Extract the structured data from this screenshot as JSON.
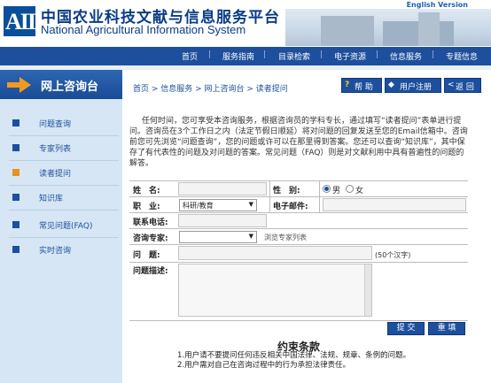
{
  "header": {
    "logo_mark": "AII",
    "title_cn": "中国农业科技文献与信息服务平台",
    "title_en": "National Agricultural Information System",
    "english_link": "English Version"
  },
  "nav": {
    "items": [
      "首页",
      "服务指南",
      "目录检索",
      "电子资源",
      "信息服务",
      "专题信息"
    ]
  },
  "sidebar": {
    "heading": "网上咨询台",
    "items": [
      "问题查询",
      "专家列表",
      "读者提问",
      "知识库",
      "常见问题(FAQ)",
      "实时咨询"
    ]
  },
  "breadcrumb": "首页 > 信息服务 > 网上咨询台 > 读者提问",
  "toolbar": {
    "help": "帮 助",
    "register": "用户注册",
    "back": "返 回"
  },
  "intro": "任何时间，您可享受本咨询服务，根据咨询员的学科专长，通过填写“读者提问”表单进行提问。咨询员在3个工作日之内（法定节假日顺延）将对问题的回复发送至您的Email信箱中。咨询前您可先浏览“问题查询”，您的问题或许可以在那里得到答案。您还可以查询“知识库”，其中保存了有代表性的问题及对问题的答案。常见问题（FAQ）则是对文献利用中具有普遍性的问题的解答。",
  "form": {
    "name_label": "姓　名:",
    "gender_label": "性　别:",
    "gender_options": [
      "男",
      "女"
    ],
    "gender_selected": "男",
    "job_label": "职　业:",
    "job_value": "科研/教育",
    "email_label": "电子邮件:",
    "phone_label": "联系电话:",
    "expert_label": "咨询专家:",
    "expert_hint": "浏览专家列表",
    "question_label": "问　题:",
    "question_hint": "(50个汉字)",
    "desc_label": "问题描述:",
    "submit": "提 交",
    "reset": "重 填"
  },
  "terms": {
    "title": "约束条款",
    "lines": [
      "1.用户请不要提问任何违反相关中国法律、法规、规章、条例的问题。",
      "2.用户需对自己在咨询过程中的行为承担法律责任。"
    ]
  },
  "colors": {
    "brand": "#1d4f9d",
    "sidebar_bg": "#d6e6f5",
    "active_marker": "#e8911f"
  }
}
